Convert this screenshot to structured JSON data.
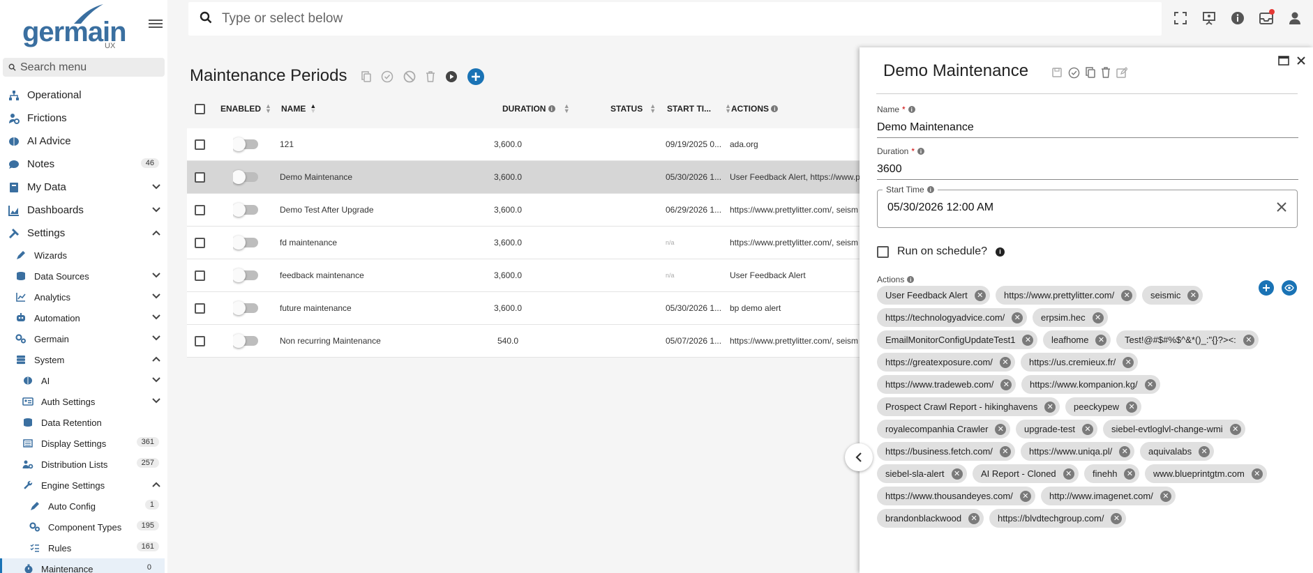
{
  "brand": {
    "name": "germain",
    "suffix": "UX"
  },
  "search_menu": {
    "placeholder": "Search menu"
  },
  "nav": [
    {
      "label": "Operational"
    },
    {
      "label": "Frictions"
    },
    {
      "label": "AI Advice"
    },
    {
      "label": "Notes",
      "badge": "46"
    },
    {
      "label": "My Data"
    },
    {
      "label": "Dashboards"
    },
    {
      "label": "Settings"
    }
  ],
  "settings_sub": [
    {
      "label": "Wizards"
    },
    {
      "label": "Data Sources"
    },
    {
      "label": "Analytics"
    },
    {
      "label": "Automation"
    },
    {
      "label": "Germain"
    },
    {
      "label": "System"
    }
  ],
  "system_sub": [
    {
      "label": "AI"
    },
    {
      "label": "Auth Settings"
    },
    {
      "label": "Data Retention"
    },
    {
      "label": "Display Settings",
      "badge": "361"
    },
    {
      "label": "Distribution Lists",
      "badge": "257"
    },
    {
      "label": "Engine Settings"
    }
  ],
  "engine_sub": [
    {
      "label": "Auto Config",
      "badge": "1"
    },
    {
      "label": "Component Types",
      "badge": "195"
    },
    {
      "label": "Rules",
      "badge": "161"
    },
    {
      "label": "Maintenance",
      "badge": "0"
    }
  ],
  "topbar": {
    "placeholder": "Type or select below"
  },
  "page": {
    "title": "Maintenance Periods"
  },
  "grid": {
    "columns": {
      "enabled": "ENABLED",
      "name": "NAME",
      "duration": "DURATION",
      "status": "STATUS",
      "start": "START TI...",
      "actions": "ACTIONS"
    },
    "rows": [
      {
        "name": "121",
        "duration": "3,600.0",
        "start": "09/19/2025 0...",
        "actions": "ada.org"
      },
      {
        "name": "Demo Maintenance",
        "duration": "3,600.0",
        "start": "05/30/2026 1...",
        "actions": "User Feedback Alert, https://www.pr"
      },
      {
        "name": "Demo Test After Upgrade",
        "duration": "3,600.0",
        "start": "06/29/2026 1...",
        "actions": "https://www.prettylitter.com/, seism"
      },
      {
        "name": "fd maintenance",
        "duration": "3,600.0",
        "start": "n/a",
        "actions": "https://www.prettylitter.com/, seism"
      },
      {
        "name": "feedback maintenance",
        "duration": "3,600.0",
        "start": "n/a",
        "actions": "User Feedback Alert"
      },
      {
        "name": "future maintenance",
        "duration": "3,600.0",
        "start": "05/30/2026 1...",
        "actions": "bp demo alert"
      },
      {
        "name": "Non recurring Maintenance",
        "duration": "540.0",
        "start": "05/07/2026 1...",
        "actions": "https://www.prettylitter.com/, seism"
      }
    ]
  },
  "panel": {
    "title": "Demo Maintenance",
    "name_label": "Name",
    "name_value": "Demo Maintenance",
    "duration_label": "Duration",
    "duration_value": "3600",
    "start_label": "Start Time",
    "start_value": "05/30/2026 12:00 AM",
    "run_label": "Run on schedule?",
    "actions_label": "Actions",
    "chips": [
      "User Feedback Alert",
      "https://www.prettylitter.com/",
      "seismic",
      "https://technologyadvice.com/",
      "erpsim.hec",
      "EmailMonitorConfigUpdateTest1",
      "leafhome",
      "Test!@#$#%$^&*()_:\"{}?><:",
      "https://greatexposure.com/",
      "https://us.cremieux.fr/",
      "https://www.tradeweb.com/",
      "https://www.kompanion.kg/",
      "Prospect Crawl Report - hikinghavens",
      "peeckypew",
      "royalecompanhia Crawler",
      "upgrade-test",
      "siebel-evtloglvl-change-wmi",
      "https://business.fetch.com/",
      "https://www.uniqa.pl/",
      "aquivalabs",
      "siebel-sla-alert",
      "AI Report - Cloned",
      "finehh",
      "www.blueprintgtm.com",
      "https://www.thousandeyes.com/",
      "http://www.imagenet.com/",
      "brandonblackwood",
      "https://blvdtechgroup.com/"
    ]
  }
}
